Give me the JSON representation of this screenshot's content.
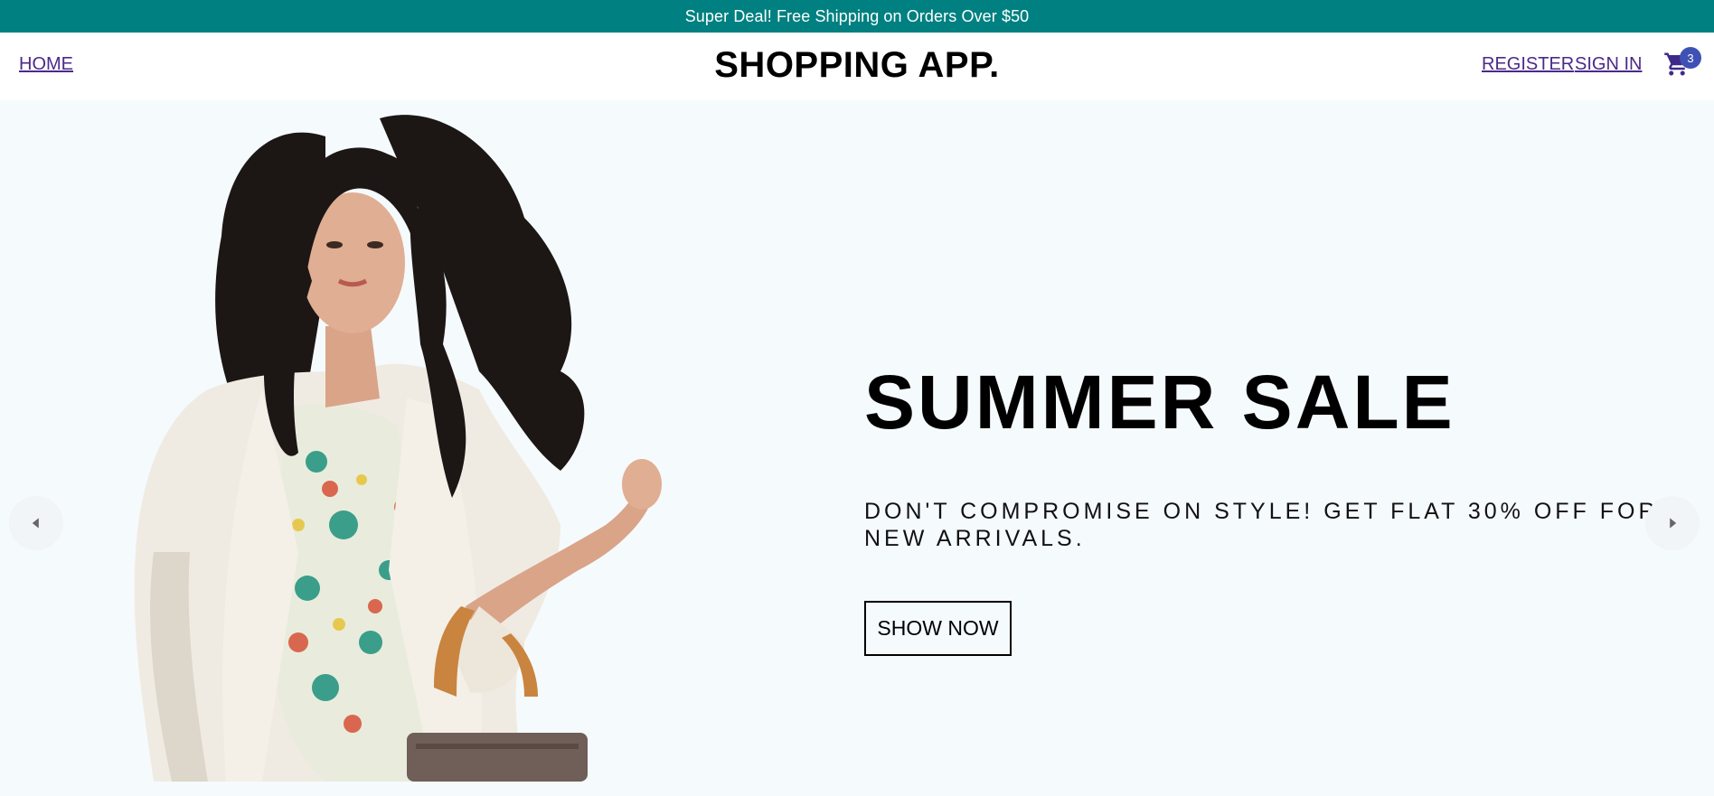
{
  "announcement": {
    "text": "Super Deal! Free Shipping on Orders Over $50"
  },
  "navbar": {
    "home_label": "HOME",
    "logo": "SHOPPING APP.",
    "register_label": "REGISTER",
    "signin_label": "SIGN IN",
    "cart_icon": "shopping-cart-icon",
    "cart_count": "3"
  },
  "slider": {
    "active_slide": {
      "title": "SUMMER SALE",
      "description": "DON'T COMPROMISE ON STYLE! GET FLAT 30% OFF FOR NEW ARRIVALS.",
      "button_label": "SHOW NOW",
      "image": "woman-with-handbag-photo"
    },
    "prev_icon": "arrow-left-icon",
    "next_icon": "arrow-right-icon"
  },
  "colors": {
    "announcement_bg": "#008080",
    "link": "#4b2a8a",
    "badge": "#3f51b5",
    "slide_bg": "#f5fafd"
  }
}
